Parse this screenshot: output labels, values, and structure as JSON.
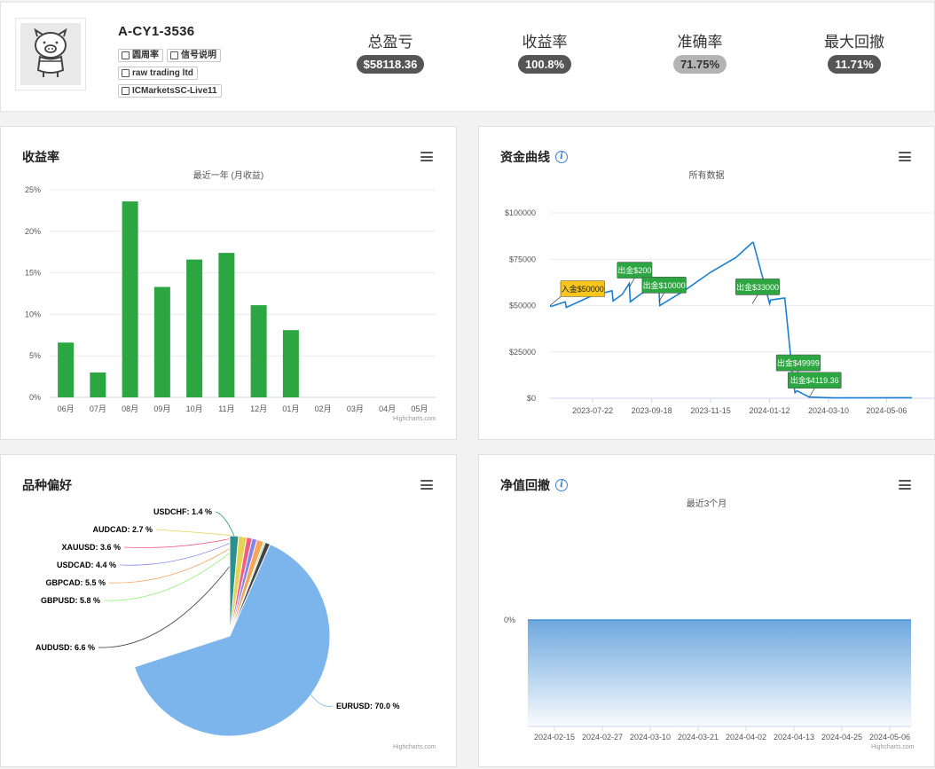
{
  "account": {
    "name": "A-CY1-3536",
    "tags": [
      "圆周率",
      "信号说明",
      "raw trading ltd",
      "ICMarketsSC-Live11"
    ]
  },
  "stats": [
    {
      "label": "总盈亏",
      "value": "$58118.36"
    },
    {
      "label": "收益率",
      "value": "100.8%"
    },
    {
      "label": "准确率",
      "value": "71.75%"
    },
    {
      "label": "最大回撤",
      "value": "11.71%"
    }
  ],
  "cards": {
    "returns": {
      "title": "收益率",
      "subtitle": "最近一年 (月收益)"
    },
    "equity": {
      "title": "资金曲线",
      "subtitle": "所有数据"
    },
    "symbols": {
      "title": "品种偏好"
    },
    "drawdown": {
      "title": "净值回撤",
      "subtitle": "最近3个月"
    }
  },
  "credit": "Highcharts.com",
  "colors": {
    "bar": "#2ba640",
    "line": "#1a7fd4",
    "green_flag": "#2ba640",
    "yellow_flag": "#f7c51b",
    "area": "#6ea8de"
  },
  "chart_data": [
    {
      "type": "bar",
      "title": "收益率",
      "subtitle": "最近一年 (月收益)",
      "categories": [
        "06月",
        "07月",
        "08月",
        "09月",
        "10月",
        "11月",
        "12月",
        "01月",
        "02月",
        "03月",
        "04月",
        "05月"
      ],
      "values": [
        6.6,
        3.0,
        23.6,
        13.3,
        16.6,
        17.4,
        11.1,
        8.1,
        null,
        null,
        null,
        null
      ],
      "ylim": [
        0,
        25
      ],
      "yticks": [
        "0%",
        "5%",
        "10%",
        "15%",
        "20%",
        "25%"
      ],
      "grid": true
    },
    {
      "type": "line",
      "title": "资金曲线",
      "subtitle": "所有数据",
      "xticks": [
        "2023-07-22",
        "2023-09-18",
        "2023-11-15",
        "2024-01-12",
        "2024-03-10",
        "2024-05-06"
      ],
      "yticks": [
        "$0",
        "$25000",
        "$50000",
        "$75000",
        "$100000"
      ],
      "ylim": [
        0,
        100000
      ],
      "x_range": [
        "2023-06-10",
        "2024-05-31"
      ],
      "series": [
        {
          "x": [
            "2023-06-10",
            "2023-06-11",
            "2023-06-25",
            "2023-06-26",
            "2023-07-20",
            "2023-08-10",
            "2023-08-11",
            "2023-08-20",
            "2023-08-27",
            "2023-08-28",
            "2023-09-08",
            "2023-09-25",
            "2023-09-26",
            "2023-10-20",
            "2023-11-15",
            "2023-12-10",
            "2023-12-26",
            "2023-12-27",
            "2024-01-12",
            "2024-01-13",
            "2024-01-26",
            "2024-01-27",
            "2024-02-04",
            "2024-02-06",
            "2024-02-08",
            "2024-02-20",
            "2024-03-15",
            "2024-05-31"
          ],
          "y": [
            50000,
            49500,
            52000,
            49000,
            55000,
            58000,
            52500,
            56000,
            62000,
            52000,
            56500,
            60000,
            50000,
            58000,
            68000,
            76000,
            84000,
            84000,
            51000,
            53000,
            54000,
            54000,
            10000,
            3000,
            4000,
            600,
            200,
            300
          ]
        }
      ],
      "annotations": [
        {
          "text": "入金$50000",
          "x": "2023-06-10",
          "y": 50000,
          "kind": "deposit"
        },
        {
          "text": "出金$200",
          "x": "2023-08-27",
          "y": 60000,
          "kind": "withdraw"
        },
        {
          "text": "出金$10000",
          "x": "2023-09-25",
          "y": 52000,
          "kind": "withdraw"
        },
        {
          "text": "出金$33000",
          "x": "2023-12-26",
          "y": 51000,
          "kind": "withdraw"
        },
        {
          "text": "出金$49999",
          "x": "2024-02-04",
          "y": 10000,
          "kind": "withdraw"
        },
        {
          "text": "出金$4119.36",
          "x": "2024-02-20",
          "y": 600,
          "kind": "withdraw"
        }
      ]
    },
    {
      "type": "pie",
      "title": "品种偏好",
      "slices": [
        {
          "label": "EURUSD",
          "value": 70.0,
          "color": "#7cb5ec"
        },
        {
          "label": "AUDUSD",
          "value": 6.6,
          "color": "#434348"
        },
        {
          "label": "GBPUSD",
          "value": 5.8,
          "color": "#90ed7d"
        },
        {
          "label": "GBPCAD",
          "value": 5.5,
          "color": "#f7a35c"
        },
        {
          "label": "USDCAD",
          "value": 4.4,
          "color": "#8085e9"
        },
        {
          "label": "XAUUSD",
          "value": 3.6,
          "color": "#f15c80"
        },
        {
          "label": "AUDCAD",
          "value": 2.7,
          "color": "#e4d354"
        },
        {
          "label": "USDCHF",
          "value": 1.4,
          "color": "#2b908f"
        }
      ]
    },
    {
      "type": "area",
      "title": "净值回撤",
      "subtitle": "最近3个月",
      "xticks": [
        "2024-02-15",
        "2024-02-27",
        "2024-03-10",
        "2024-03-21",
        "2024-04-02",
        "2024-04-13",
        "2024-04-25",
        "2024-05-06"
      ],
      "yticks": [
        "0%"
      ],
      "values": [
        0,
        0,
        0,
        0,
        0,
        0,
        0,
        0
      ]
    }
  ]
}
